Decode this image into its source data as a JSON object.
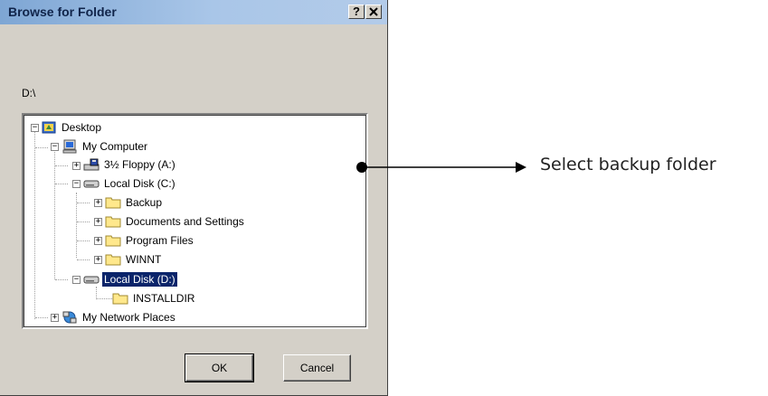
{
  "dialog": {
    "title": "Browse for Folder",
    "help_label": "?",
    "close_label": "✕",
    "current_path": "D:\\",
    "ok_label": "OK",
    "cancel_label": "Cancel"
  },
  "tree": {
    "nodes": [
      {
        "label": "Desktop",
        "icon": "desktop-icon",
        "expander": "minus"
      },
      {
        "label": "My Computer",
        "icon": "computer-icon",
        "expander": "minus"
      },
      {
        "label": "3½ Floppy (A:)",
        "icon": "floppy-drive-icon",
        "expander": "plus"
      },
      {
        "label": "Local Disk (C:)",
        "icon": "hard-drive-icon",
        "expander": "minus"
      },
      {
        "label": "Backup",
        "icon": "folder-icon",
        "expander": "plus"
      },
      {
        "label": "Documents and Settings",
        "icon": "folder-icon",
        "expander": "plus"
      },
      {
        "label": "Program Files",
        "icon": "folder-icon",
        "expander": "plus"
      },
      {
        "label": "WINNT",
        "icon": "folder-icon",
        "expander": "plus"
      },
      {
        "label": "Local Disk (D:)",
        "icon": "hard-drive-icon",
        "expander": "minus",
        "selected": true
      },
      {
        "label": "INSTALLDIR",
        "icon": "folder-icon",
        "expander": "none"
      },
      {
        "label": "My Network Places",
        "icon": "network-places-icon",
        "expander": "plus"
      }
    ]
  },
  "annotation": {
    "text": "Select backup folder"
  },
  "colors": {
    "selection": "#0a246a",
    "dialog_bg": "#d4d0c8",
    "folder": "#ffe88c"
  }
}
